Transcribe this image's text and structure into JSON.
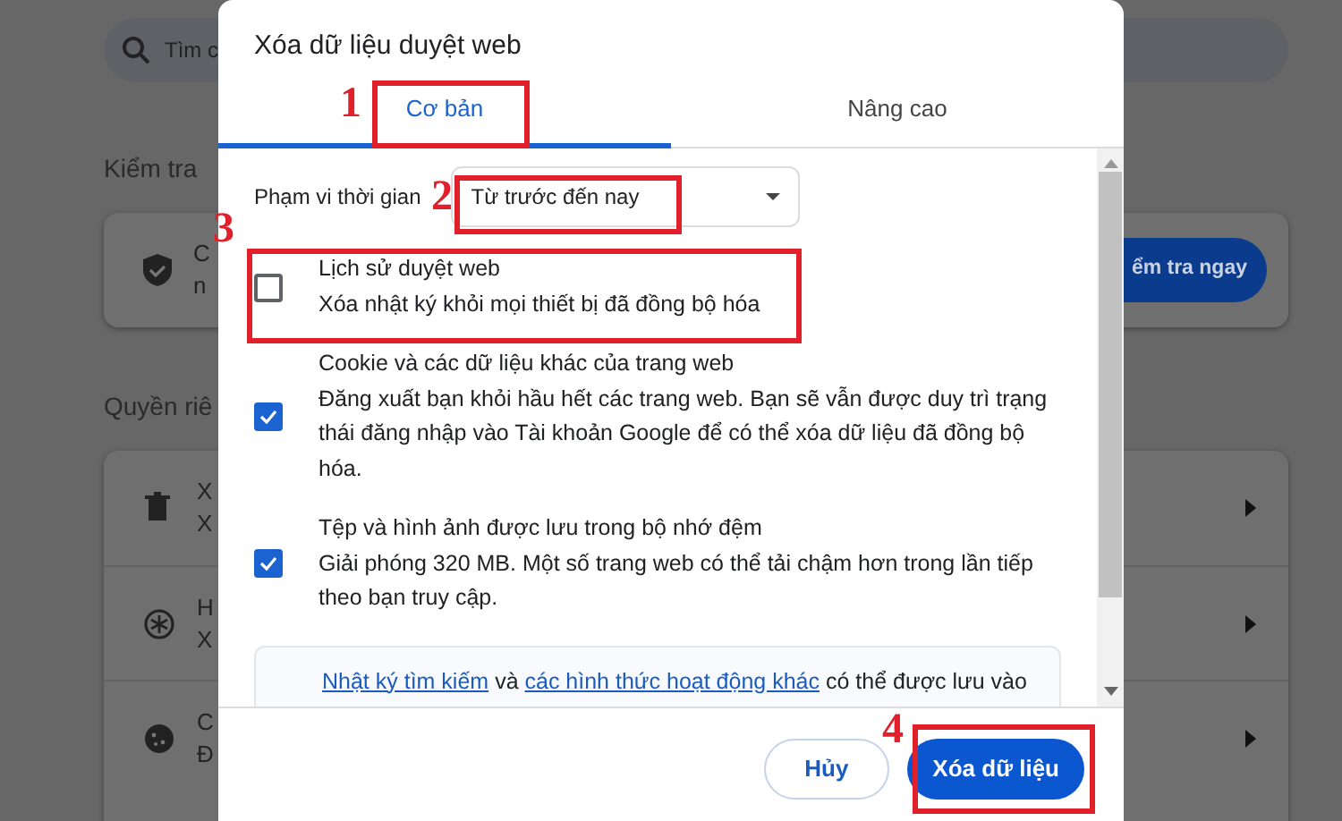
{
  "background": {
    "search": {
      "placeholder": "Tìm c"
    },
    "safety_heading": "Kiểm tra",
    "safety_card": {
      "line_1": "C",
      "line_2": "n",
      "button": "ểm tra ngay"
    },
    "privacy_heading": "Quyền riê",
    "privacy_rows": [
      {
        "kind": "trash",
        "line_1": "X",
        "line_2": "X"
      },
      {
        "kind": "gauge",
        "line_1": "H",
        "line_2": "X"
      },
      {
        "kind": "cookie",
        "line_1": "C",
        "line_2": "Đ"
      }
    ]
  },
  "dialog": {
    "title": "Xóa dữ liệu duyệt web",
    "tabs": [
      {
        "label": "Cơ bản",
        "selected": true
      },
      {
        "label": "Nâng cao",
        "selected": false
      }
    ],
    "time_range": {
      "label": "Phạm vi thời gian",
      "value": "Từ trước đến nay"
    },
    "options": [
      {
        "title": "Lịch sử duyệt web",
        "description": "Xóa nhật ký khỏi mọi thiết bị đã đồng bộ hóa",
        "checked": false
      },
      {
        "title": "Cookie và các dữ liệu khác của trang web",
        "description": "Đăng xuất bạn khỏi hầu hết các trang web. Bạn sẽ vẫn được duy trì trạng thái đăng nhập vào Tài khoản Google để có thể xóa dữ liệu đã đồng bộ hóa.",
        "checked": true
      },
      {
        "title": "Tệp và hình ảnh được lưu trong bộ nhớ đệm",
        "description": "Giải phóng 320 MB. Một số trang web có thể tải chậm hơn trong lần tiếp theo bạn truy cập.",
        "checked": true
      }
    ],
    "info": [
      {
        "text": "Nhật ký tìm kiếm",
        "link": true
      },
      {
        "text": "và",
        "link": false
      },
      {
        "text": "các hình thức hoạt động khác",
        "link": true
      },
      {
        "text": "có thể được lưu vào",
        "link": false
      }
    ],
    "buttons": [
      {
        "label": "Hủy",
        "kind": "secondary"
      },
      {
        "label": "Xóa dữ liệu",
        "kind": "primary"
      }
    ]
  },
  "annotations": [
    {
      "number": "1"
    },
    {
      "number": "2"
    },
    {
      "number": "3"
    },
    {
      "number": "4"
    }
  ]
}
